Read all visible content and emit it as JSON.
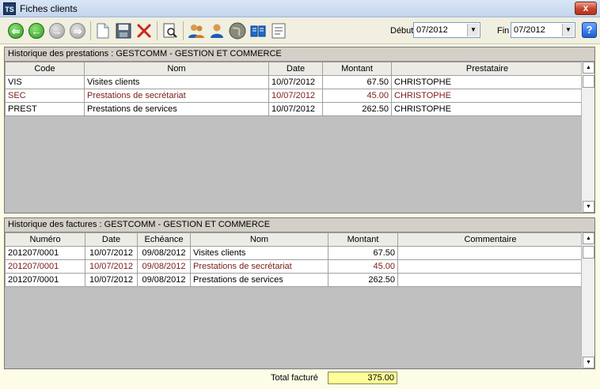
{
  "window": {
    "title": "Fiches clients",
    "icon_label": "TS",
    "close_label": "x"
  },
  "toolbar": {
    "buttons": [
      {
        "name": "first-icon",
        "glyph": "⇐"
      },
      {
        "name": "prev-icon",
        "glyph": "←"
      },
      {
        "name": "next-icon",
        "glyph": "→"
      },
      {
        "name": "last-icon",
        "glyph": "⇒"
      },
      {
        "name": "new-document-icon",
        "glyph": ""
      },
      {
        "name": "save-icon",
        "glyph": ""
      },
      {
        "name": "delete-icon",
        "glyph": "✕"
      },
      {
        "name": "preview-icon",
        "glyph": ""
      },
      {
        "name": "clients-icon",
        "glyph": ""
      },
      {
        "name": "contact-icon",
        "glyph": ""
      },
      {
        "name": "globe-icon",
        "glyph": ""
      },
      {
        "name": "book-icon",
        "glyph": ""
      },
      {
        "name": "text-icon",
        "glyph": ""
      }
    ],
    "debut_label": "Début",
    "debut_value": "07/2012",
    "fin_label": "Fin",
    "fin_value": "07/2012",
    "help_label": "?"
  },
  "prestations": {
    "title": "Historique des prestations : GESTCOMM - GESTION ET COMMERCE",
    "columns": [
      "Code",
      "Nom",
      "Date",
      "Montant",
      "Prestataire"
    ],
    "rows": [
      {
        "code": "VIS",
        "nom": "Visites clients",
        "date": "10/07/2012",
        "montant": "67.50",
        "prestataire": "CHRISTOPHE"
      },
      {
        "code": "SEC",
        "nom": "Prestations de secrétariat",
        "date": "10/07/2012",
        "montant": "45.00",
        "prestataire": "CHRISTOPHE"
      },
      {
        "code": "PREST",
        "nom": "Prestations de services",
        "date": "10/07/2012",
        "montant": "262.50",
        "prestataire": "CHRISTOPHE"
      }
    ]
  },
  "factures": {
    "title": "Historique des factures : GESTCOMM - GESTION ET COMMERCE",
    "columns": [
      "Numéro",
      "Date",
      "Echéance",
      "Nom",
      "Montant",
      "Commentaire"
    ],
    "rows": [
      {
        "numero": "201207/0001",
        "date": "10/07/2012",
        "echeance": "09/08/2012",
        "nom": "Visites clients",
        "montant": "67.50",
        "commentaire": ""
      },
      {
        "numero": "201207/0001",
        "date": "10/07/2012",
        "echeance": "09/08/2012",
        "nom": "Prestations de secrétariat",
        "montant": "45.00",
        "commentaire": ""
      },
      {
        "numero": "201207/0001",
        "date": "10/07/2012",
        "echeance": "09/08/2012",
        "nom": "Prestations de services",
        "montant": "262.50",
        "commentaire": ""
      }
    ]
  },
  "footer": {
    "total_label": "Total facturé",
    "total_value": "375.00"
  }
}
